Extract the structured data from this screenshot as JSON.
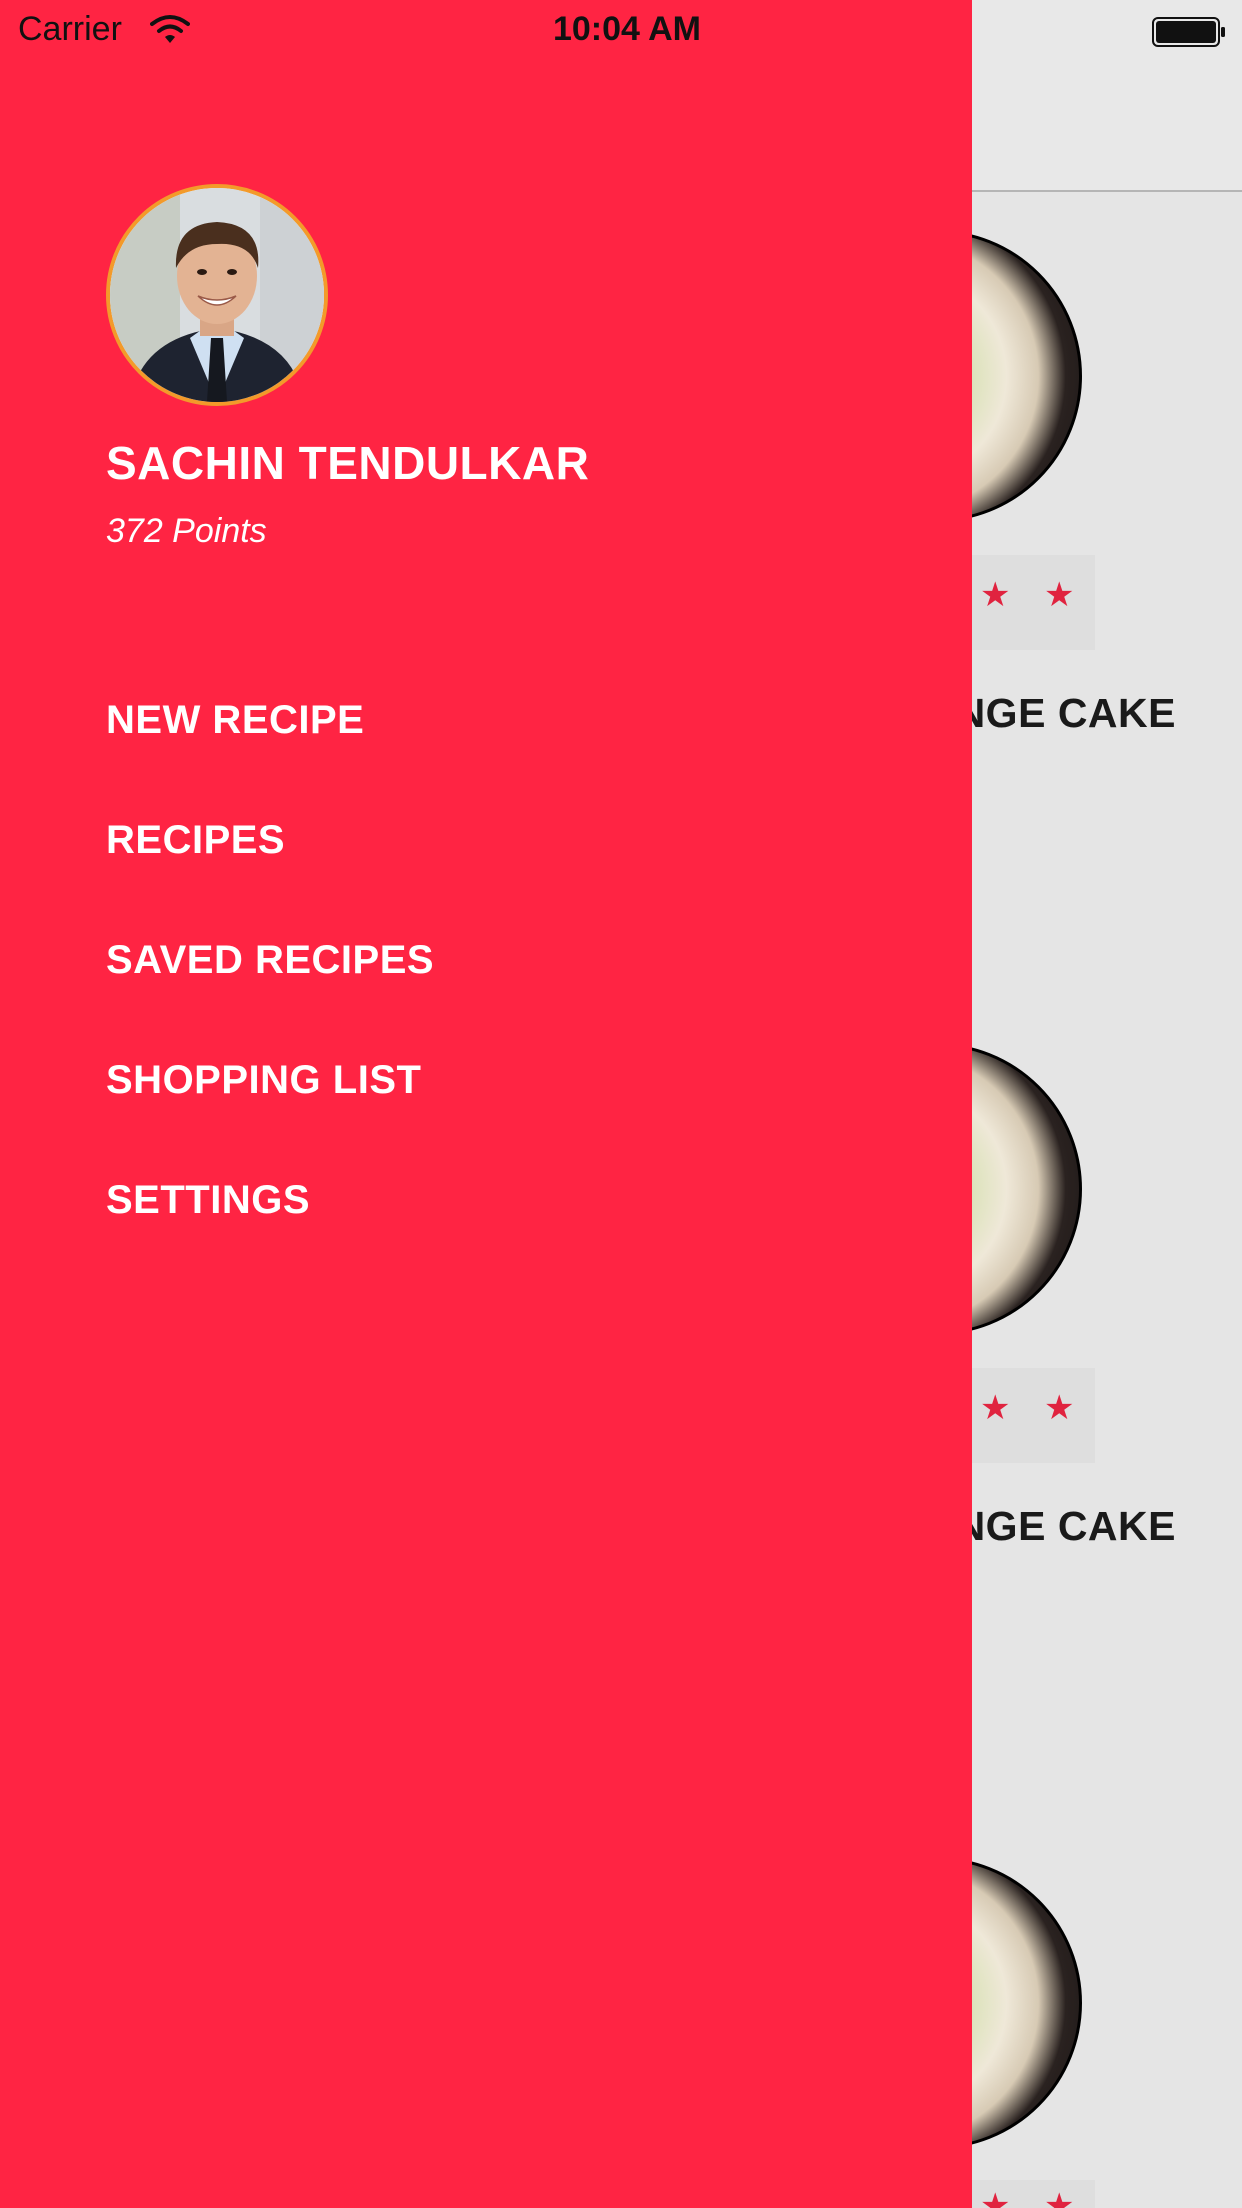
{
  "status_bar": {
    "carrier": "Carrier",
    "time": "10:04 AM"
  },
  "drawer": {
    "background_color": "#ff2443",
    "profile": {
      "name": "SACHIN TENDULKAR",
      "points": "372 Points",
      "avatar_icon": "user-photo"
    },
    "menu": [
      {
        "label": "NEW RECIPE"
      },
      {
        "label": "RECIPES"
      },
      {
        "label": "SAVED RECIPES"
      },
      {
        "label": "SHOPPING LIST"
      },
      {
        "label": "SETTINGS"
      }
    ]
  },
  "background_list": {
    "accent_color": "#e0233f",
    "cards": [
      {
        "title": "NGE CAKE"
      },
      {
        "title": "NGE CAKE"
      },
      {
        "title": ""
      }
    ]
  }
}
